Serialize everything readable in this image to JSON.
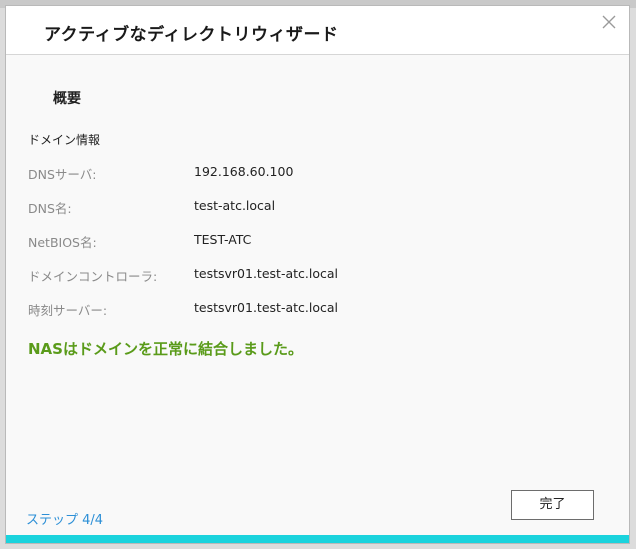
{
  "dialog": {
    "title": "アクティブなディレクトリウィザード",
    "close_icon": "close-icon",
    "section_title": "概要",
    "info_title": "ドメイン情報",
    "rows": [
      {
        "label": "DNSサーバ:",
        "value": "192.168.60.100"
      },
      {
        "label": "DNS名:",
        "value": "test-atc.local"
      },
      {
        "label": "NetBIOS名:",
        "value": "TEST-ATC"
      },
      {
        "label": "ドメインコントローラ:",
        "value": "testsvr01.test-atc.local"
      },
      {
        "label": "時刻サーバー:",
        "value": "testsvr01.test-atc.local"
      }
    ],
    "success_message": "NASはドメインを正常に結合しました。",
    "step_text": "ステップ 4/4",
    "done_label": "完了"
  },
  "colors": {
    "success": "#5a9b1a",
    "step": "#2c8fd6",
    "accent_bar": "#1ad3dd"
  }
}
